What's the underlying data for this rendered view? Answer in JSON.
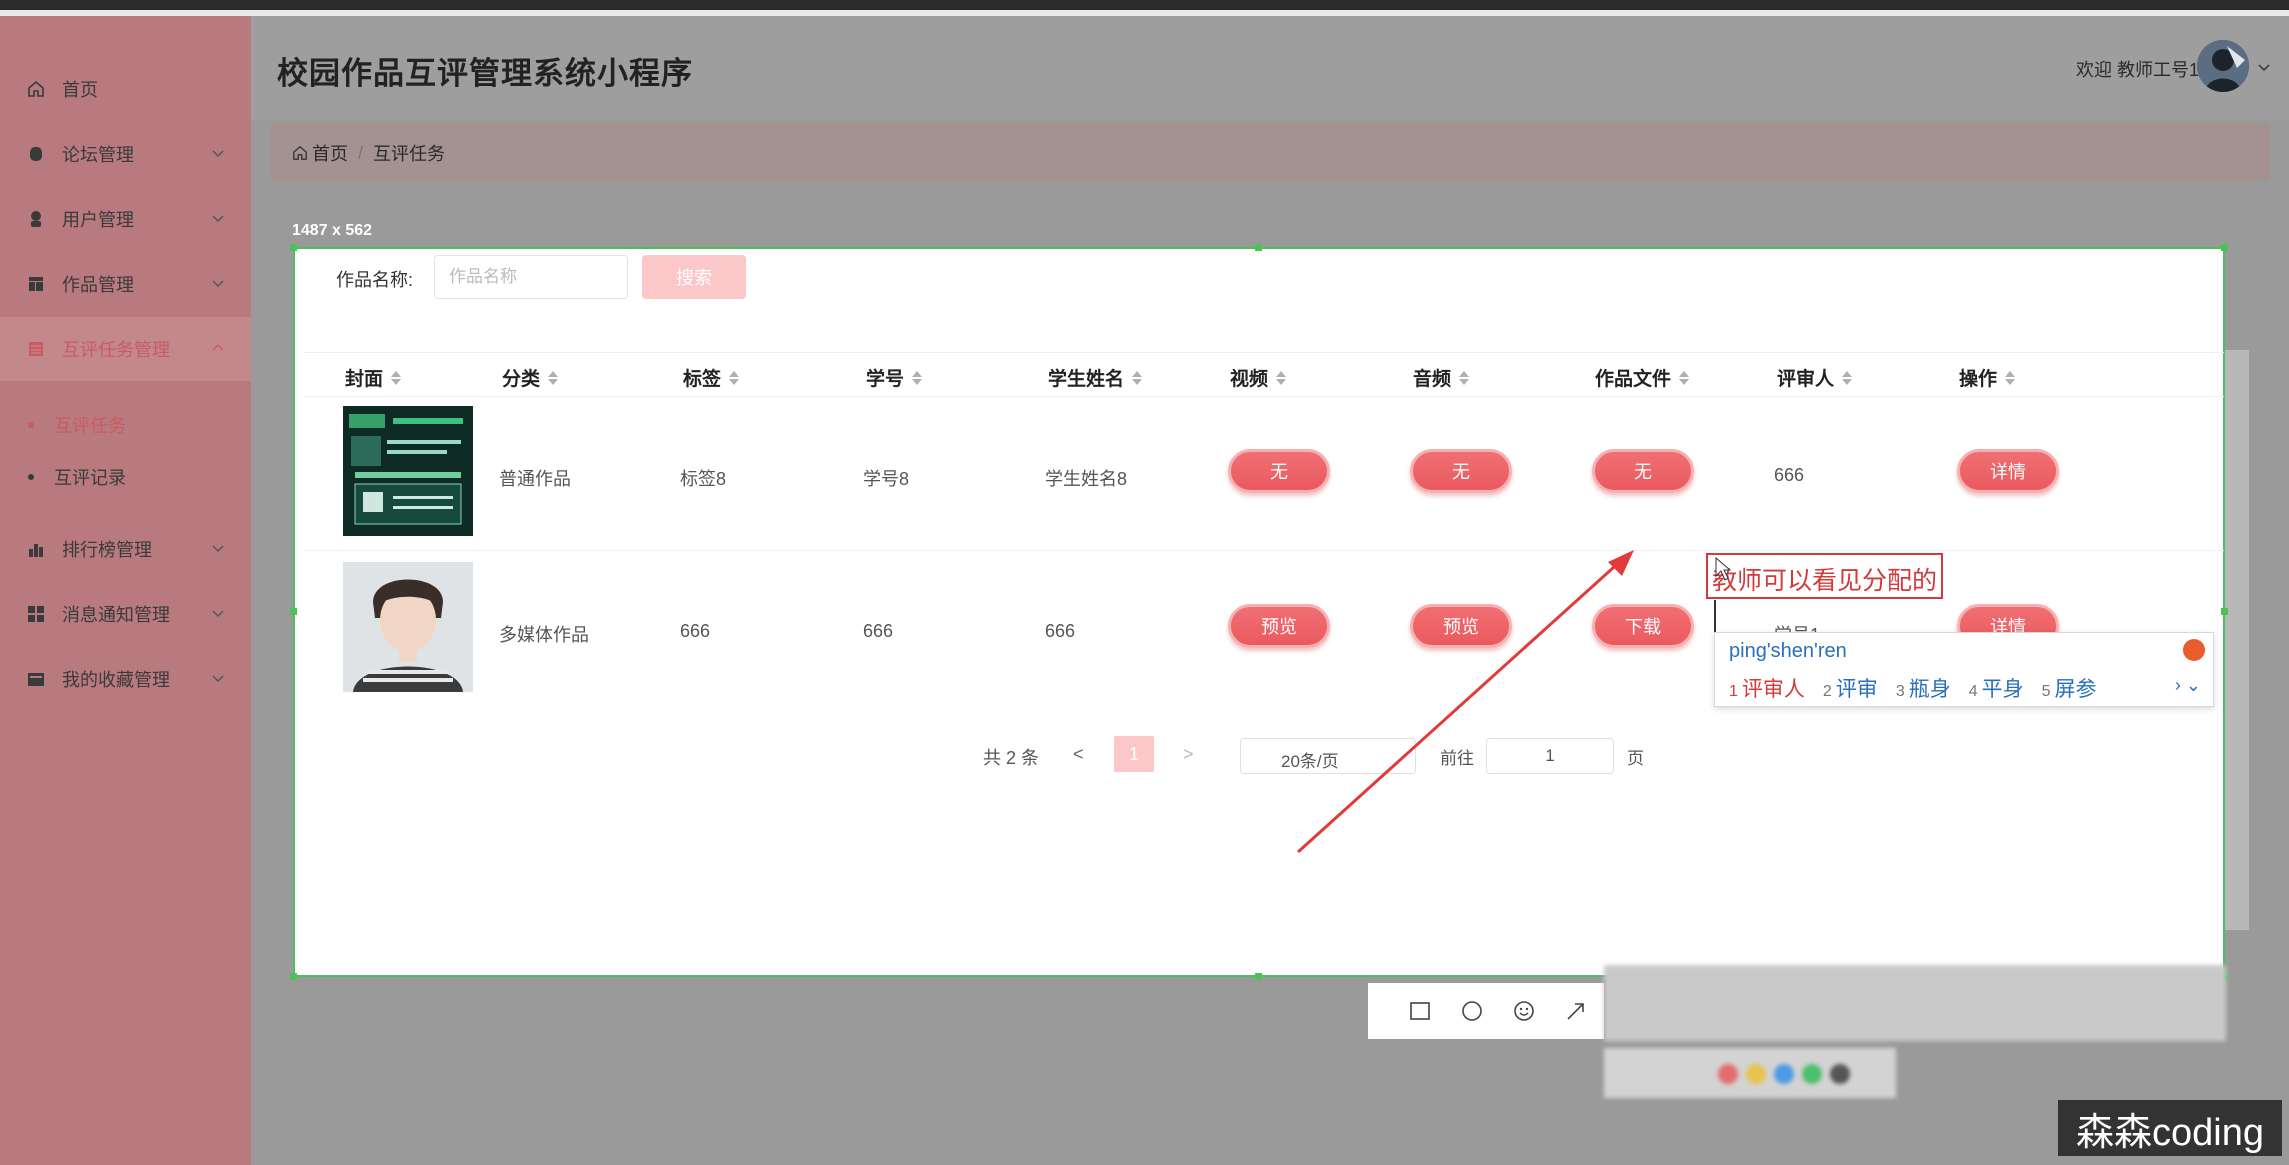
{
  "app": {
    "title": "校园作品互评管理系统小程序",
    "welcome": "欢迎 教师工号1"
  },
  "sidebar": {
    "items": [
      {
        "label": "首页",
        "icon": "home-icon"
      },
      {
        "label": "论坛管理",
        "icon": "forum-icon"
      },
      {
        "label": "用户管理",
        "icon": "user-icon"
      },
      {
        "label": "作品管理",
        "icon": "works-icon"
      },
      {
        "label": "互评任务管理",
        "icon": "task-icon"
      },
      {
        "label": "排行榜管理",
        "icon": "chart-icon"
      },
      {
        "label": "消息通知管理",
        "icon": "grid-icon"
      },
      {
        "label": "我的收藏管理",
        "icon": "folder-icon"
      }
    ],
    "subitems": [
      {
        "label": "互评任务"
      },
      {
        "label": "互评记录"
      }
    ]
  },
  "breadcrumb": {
    "home": "首页",
    "separator": "/",
    "current": "互评任务"
  },
  "screenshot": {
    "dimensions": "1487 x 562"
  },
  "search": {
    "label": "作品名称:",
    "placeholder": "作品名称",
    "button": "搜索"
  },
  "table": {
    "headers": [
      "封面",
      "分类",
      "标签",
      "学号",
      "学生姓名",
      "视频",
      "音频",
      "作品文件",
      "评审人",
      "操作"
    ],
    "rows": [
      {
        "category": "普通作品",
        "tag": "标签8",
        "student_id": "学号8",
        "student_name": "学生姓名8",
        "video": "无",
        "audio": "无",
        "file": "无",
        "reviewer": "666",
        "action": "详情"
      },
      {
        "category": "多媒体作品",
        "tag": "666",
        "student_id": "666",
        "student_name": "666",
        "video": "预览",
        "audio": "预览",
        "file": "下载",
        "reviewer": "学号1",
        "action": "详情"
      }
    ]
  },
  "pagination": {
    "total": "共 2 条",
    "prev": "<",
    "current": "1",
    "next": ">",
    "page_size": "20条/页",
    "goto": "前往",
    "goto_value": "1",
    "page_suffix": "页"
  },
  "annotation": {
    "text": "教师可以看见分配的",
    "arrow_color": "#e03a3a"
  },
  "ime": {
    "pinyin": "ping'shen'ren",
    "candidates": [
      {
        "num": "1",
        "text": "评审人"
      },
      {
        "num": "2",
        "text": "评审"
      },
      {
        "num": "3",
        "text": "瓶身"
      },
      {
        "num": "4",
        "text": "平身"
      },
      {
        "num": "5",
        "text": "屏参"
      }
    ],
    "nav": "› ⌄"
  },
  "watermark": "森森coding",
  "colors": {
    "accent": "#ea5a5f",
    "accent_light": "#fbc7c9",
    "selection": "#4cc15a"
  }
}
